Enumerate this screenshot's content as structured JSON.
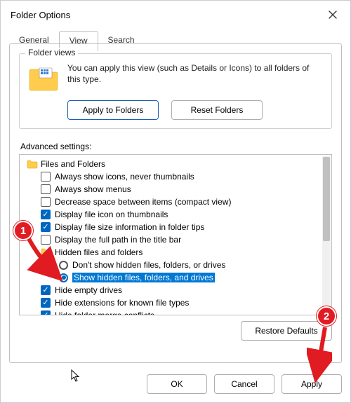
{
  "window": {
    "title": "Folder Options"
  },
  "tabs": {
    "general": "General",
    "view": "View",
    "search": "Search",
    "active": "view"
  },
  "folder_views": {
    "legend": "Folder views",
    "text": "You can apply this view (such as Details or Icons) to all folders of this type.",
    "apply_btn": "Apply to Folders",
    "reset_btn": "Reset Folders"
  },
  "advanced": {
    "label": "Advanced settings:",
    "root": "Files and Folders",
    "items": [
      {
        "kind": "check",
        "checked": false,
        "label": "Always show icons, never thumbnails"
      },
      {
        "kind": "check",
        "checked": false,
        "label": "Always show menus"
      },
      {
        "kind": "check",
        "checked": false,
        "label": "Decrease space between items (compact view)"
      },
      {
        "kind": "check",
        "checked": true,
        "label": "Display file icon on thumbnails"
      },
      {
        "kind": "check",
        "checked": true,
        "label": "Display file size information in folder tips"
      },
      {
        "kind": "check",
        "checked": false,
        "label": "Display the full path in the title bar"
      },
      {
        "kind": "folder",
        "label": "Hidden files and folders"
      },
      {
        "kind": "radio",
        "checked": false,
        "label": "Don't show hidden files, folders, or drives",
        "indent": 4
      },
      {
        "kind": "radio",
        "checked": true,
        "label": "Show hidden files, folders, and drives",
        "indent": 4,
        "selected": true
      },
      {
        "kind": "check",
        "checked": true,
        "label": "Hide empty drives"
      },
      {
        "kind": "check",
        "checked": true,
        "label": "Hide extensions for known file types"
      },
      {
        "kind": "check",
        "checked": true,
        "label": "Hide folder merge conflicts"
      }
    ]
  },
  "buttons": {
    "restore_defaults": "Restore Defaults",
    "ok": "OK",
    "cancel": "Cancel",
    "apply": "Apply"
  },
  "annotations": {
    "badge1": "1",
    "badge2": "2"
  }
}
